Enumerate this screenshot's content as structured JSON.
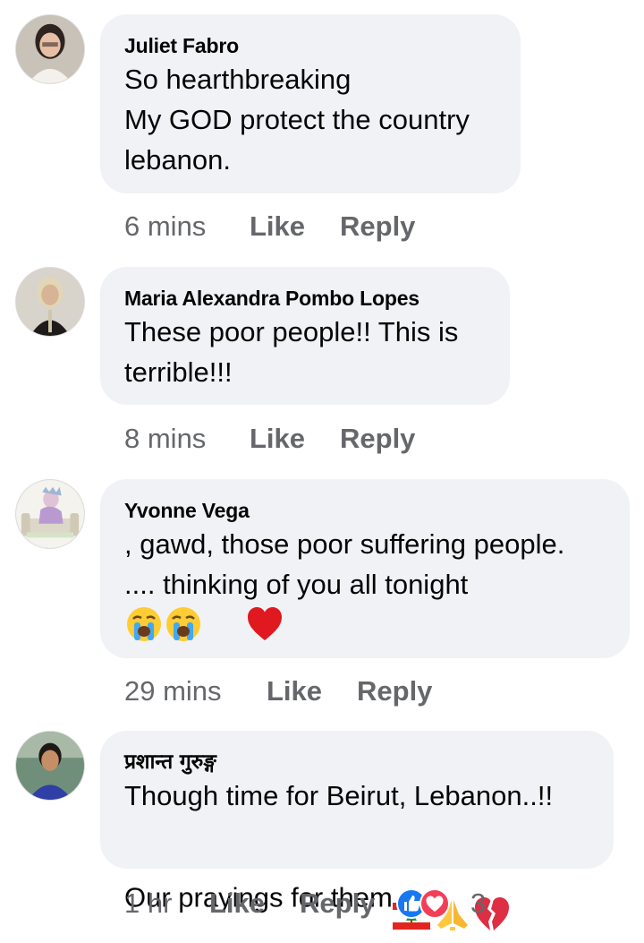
{
  "comments": [
    {
      "author": "Juliet Fabro",
      "text": "So hearthbreaking\nMy GOD protect the country\nlebanon.",
      "time": "6 mins",
      "like": "Like",
      "reply": "Reply"
    },
    {
      "author": "Maria Alexandra Pombo Lopes",
      "text": "These poor people!! This is\nterrible!!!",
      "time": "8 mins",
      "like": "Like",
      "reply": "Reply"
    },
    {
      "author": "Yvonne Vega",
      "text": ", gawd, those poor suffering people.\n.... thinking of you all tonight",
      "time": "29 mins",
      "like": "Like",
      "reply": "Reply",
      "emojis": [
        "crying-face",
        "crying-face",
        "red-heart"
      ]
    },
    {
      "author": "प्रशान्त गुरुङ्ग",
      "text_line1": "Though time for Beirut, Lebanon..!!",
      "text_line2": "Our prayings for them",
      "text_emojis": [
        "lebanon-flag",
        "folded-hands",
        "broken-heart"
      ],
      "time": "1 hr",
      "like": "Like",
      "reply": "Reply",
      "reaction_count": "3",
      "reactions": [
        "like-reaction",
        "love-reaction"
      ]
    }
  ],
  "colors": {
    "bubble": "#f0f2f5",
    "meta": "#65676b",
    "like_blue": "#1877f2",
    "love_red": "#f33e58"
  }
}
